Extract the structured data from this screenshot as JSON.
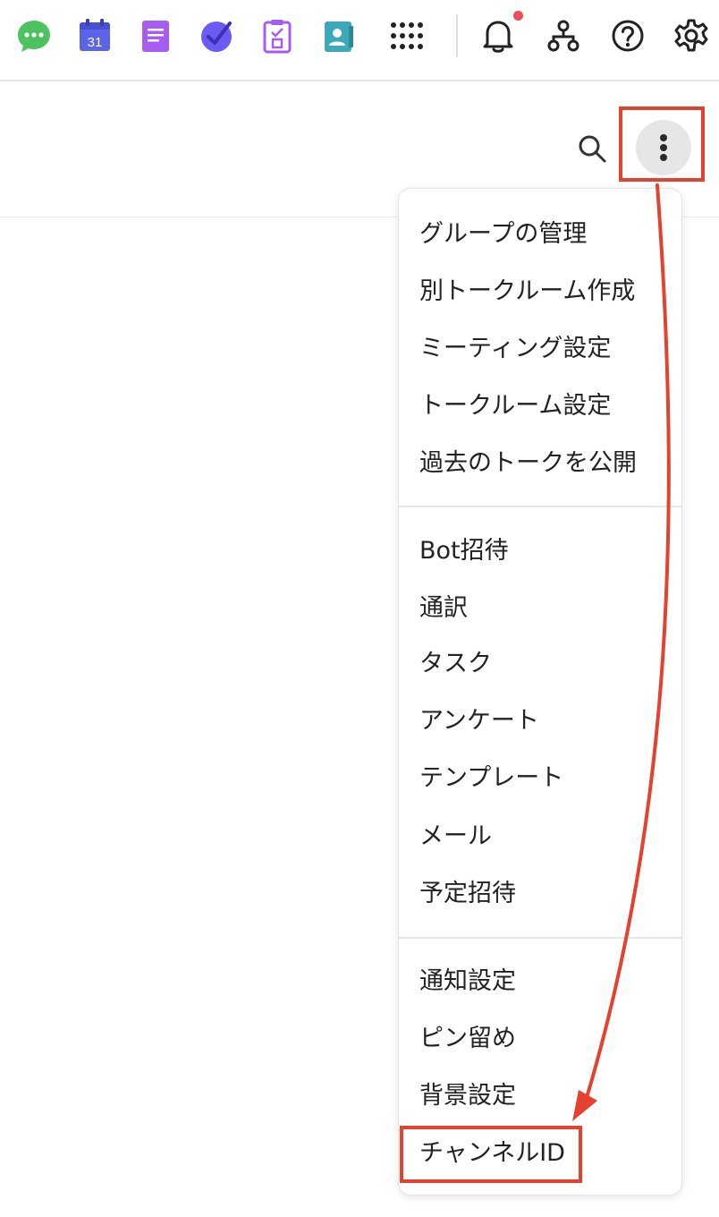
{
  "topbar": {
    "apps": [
      {
        "icon": "chat-icon",
        "color": "#4cc35f"
      },
      {
        "icon": "calendar-icon",
        "color": "#5b63e8",
        "label": "31"
      },
      {
        "icon": "note-icon",
        "color": "#a65cf0"
      },
      {
        "icon": "check-task-icon",
        "color": "#6a5cf3"
      },
      {
        "icon": "clipboard-icon",
        "color": "#a65cf0"
      },
      {
        "icon": "contacts-icon",
        "color": "#3ba9b9"
      },
      {
        "icon": "app-grid-icon",
        "color": "#222222"
      }
    ],
    "utility": [
      "bell-icon",
      "org-chart-icon",
      "help-icon",
      "gear-icon"
    ],
    "notification_dot_color": "#ef4c5a"
  },
  "subheader": {
    "search_icon": "search-icon",
    "more_icon": "more-vertical-icon"
  },
  "menu": {
    "groups": [
      [
        "グループの管理",
        "別トークルーム作成",
        "ミーティング設定",
        "トークルーム設定",
        "過去のトークを公開"
      ],
      [
        "Bot招待",
        "通訳",
        "タスク",
        "アンケート",
        "テンプレート",
        "メール",
        "予定招待"
      ],
      [
        "通知設定",
        "ピン留め",
        "背景設定",
        "チャンネルID"
      ]
    ]
  },
  "annotations": {
    "highlight_color": "#e4422e"
  }
}
